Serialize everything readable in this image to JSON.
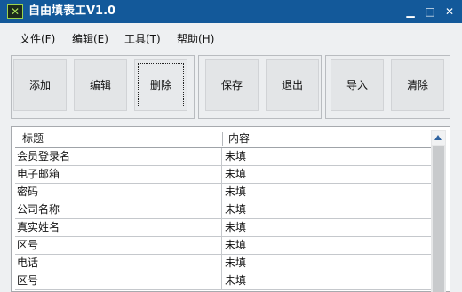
{
  "window": {
    "title": "自由填表工V1.0",
    "icon": "app-logo-icon"
  },
  "window_controls": {
    "minimize": "▁",
    "maximize": "□",
    "close": "✕"
  },
  "menu": [
    {
      "label": "文件(F)"
    },
    {
      "label": "编辑(E)"
    },
    {
      "label": "工具(T)"
    },
    {
      "label": "帮助(H)"
    }
  ],
  "toolbar": {
    "add": "添加",
    "edit": "编辑",
    "delete": "删除",
    "save": "保存",
    "exit": "退出",
    "import": "导入",
    "clear": "清除"
  },
  "list": {
    "headers": {
      "title": "标题",
      "content": "内容"
    },
    "rows": [
      {
        "title": "会员登录名",
        "content": "未填"
      },
      {
        "title": "电子邮箱",
        "content": "未填"
      },
      {
        "title": "密码",
        "content": "未填"
      },
      {
        "title": "公司名称",
        "content": "未填"
      },
      {
        "title": "真实姓名",
        "content": "未填"
      },
      {
        "title": "区号",
        "content": "未填"
      },
      {
        "title": "电话",
        "content": "未填"
      },
      {
        "title": "区号",
        "content": "未填"
      }
    ]
  },
  "colors": {
    "titlebar": "#13599a",
    "window_bg": "#eef0f2",
    "button_bg": "#e3e5e7",
    "scroll_arrow": "#2f63a0"
  }
}
